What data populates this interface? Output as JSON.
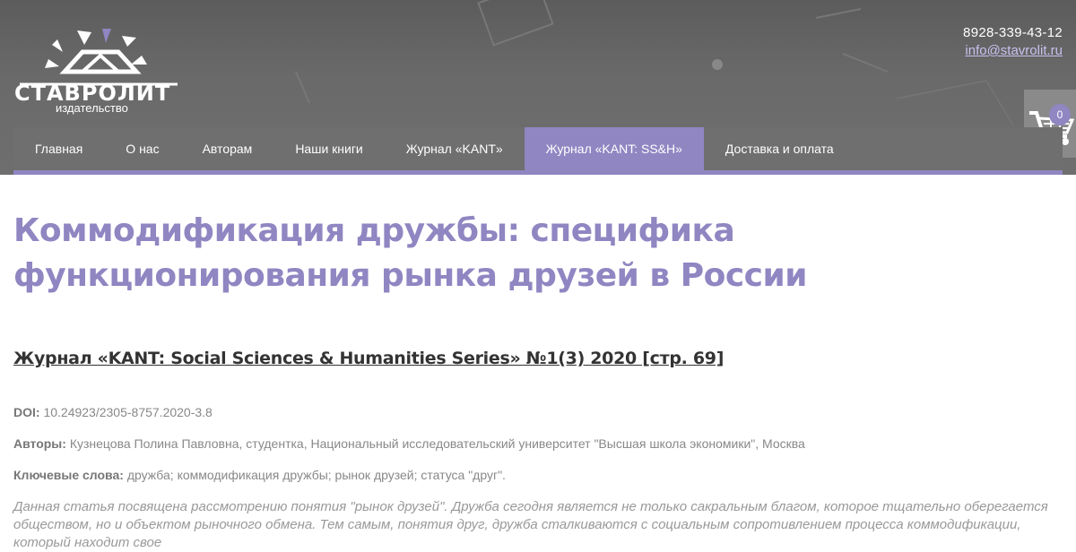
{
  "brand": {
    "logo_text": "СТАВРОЛИТ",
    "subtitle": "издательство",
    "accent_color": "#8f86c2"
  },
  "contacts": {
    "phone": "8928-339-43-12",
    "email": "info@stavrolit.ru"
  },
  "cart": {
    "icon": "shopping-cart-icon",
    "count": "0"
  },
  "nav": {
    "items": [
      {
        "label": "Главная"
      },
      {
        "label": "О нас"
      },
      {
        "label": "Авторам"
      },
      {
        "label": "Наши книги"
      },
      {
        "label": "Журнал «KANT»"
      },
      {
        "label": "Журнал «KANT: SS&H»",
        "active": true
      },
      {
        "label": "Доставка и оплата"
      }
    ]
  },
  "article": {
    "title": "Коммодификация дружбы: специфика функционирования рынка друзей в России",
    "journal_link": "Журнал «KANT: Social Sciences & Humanities Series» №1(3) 2020 [стр. 69]",
    "doi_label": "DOI:",
    "doi": "10.24923/2305-8757.2020-3.8",
    "authors_label": "Авторы:",
    "authors": "Кузнецова Полина Павловна, студентка, Национальный исследовательский университет \"Высшая школа экономики\", Москва",
    "keywords_label": "Ключевые слова:",
    "keywords": "дружба; коммодификация дружбы; рынок друзей; статуса \"друг\".",
    "abstract": "Данная статья посвящена рассмотрению понятия \"рынок друзей\". Дружба сегодня является не только сакральным благом, которое тщательно оберегается обществом, но и объектом рыночного обмена. Тем самым, понятия друг, дружба сталкиваются с социальным сопротивлением процесса коммодификации, который находит свое"
  }
}
